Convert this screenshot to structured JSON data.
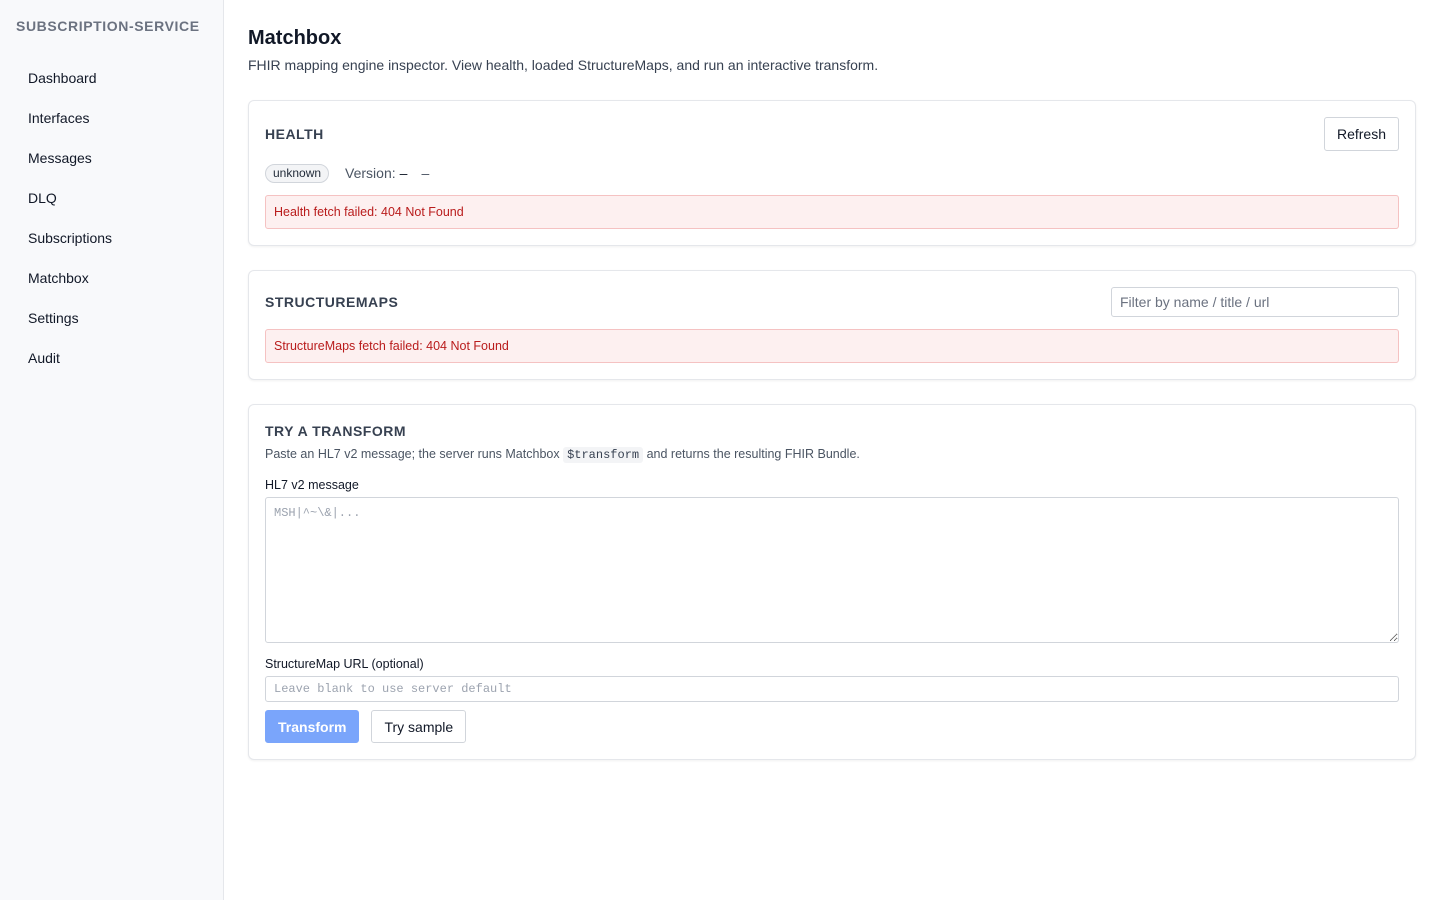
{
  "sidebar": {
    "brand": "SUBSCRIPTION-SERVICE",
    "items": [
      {
        "label": "Dashboard"
      },
      {
        "label": "Interfaces"
      },
      {
        "label": "Messages"
      },
      {
        "label": "DLQ"
      },
      {
        "label": "Subscriptions"
      },
      {
        "label": "Matchbox"
      },
      {
        "label": "Settings"
      },
      {
        "label": "Audit"
      }
    ]
  },
  "page": {
    "title": "Matchbox",
    "subtitle": "FHIR mapping engine inspector. View health, loaded StructureMaps, and run an interactive transform."
  },
  "health": {
    "title": "HEALTH",
    "refresh_label": "Refresh",
    "status_badge": "unknown",
    "version_label": "Version:",
    "version_value": "–",
    "uptime_value": "–",
    "error": "Health fetch failed: 404 Not Found"
  },
  "structuremaps": {
    "title": "STRUCTUREMAPS",
    "filter_placeholder": "Filter by name / title / url",
    "error": "StructureMaps fetch failed: 404 Not Found"
  },
  "transform": {
    "title": "TRY A TRANSFORM",
    "help_prefix": "Paste an HL7 v2 message; the server runs Matchbox",
    "help_code": "$transform",
    "help_suffix": "and returns the resulting FHIR Bundle.",
    "message_label": "HL7 v2 message",
    "message_placeholder": "MSH|^~\\&|...",
    "url_label": "StructureMap URL (optional)",
    "url_placeholder": "Leave blank to use server default",
    "transform_label": "Transform",
    "sample_label": "Try sample"
  },
  "colors": {
    "primary_button": "#7aa5fb",
    "error_bg": "#fdf0f0",
    "error_text": "#b91c1c",
    "sidebar_bg": "#f8f9fb"
  }
}
